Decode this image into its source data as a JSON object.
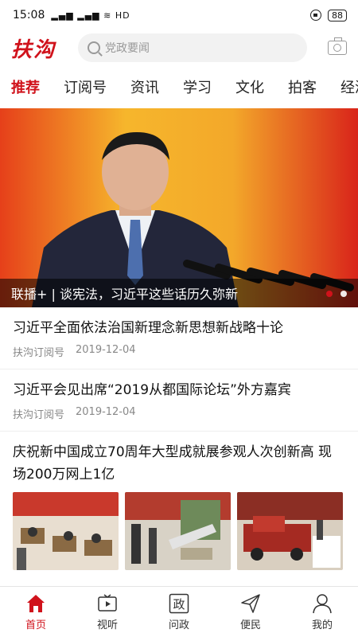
{
  "status_bar": {
    "time": "15:08",
    "signal": "▂▄▆ ▂▄▆ ≋ HD",
    "battery": "88"
  },
  "header": {
    "logo": "扶沟",
    "search_placeholder": "党政要闻"
  },
  "tabs": [
    "推荐",
    "订阅号",
    "资讯",
    "学习",
    "文化",
    "拍客",
    "经济"
  ],
  "banner": {
    "caption": "联播+ | 谈宪法，习近平这些话历久弥新"
  },
  "news": [
    {
      "title": "习近平全面依法治国新理念新思想新战略十论",
      "source": "扶沟订阅号",
      "date": "2019-12-04"
    },
    {
      "title": "习近平会见出席“2019从都国际论坛”外方嘉宾",
      "source": "扶沟订阅号",
      "date": "2019-12-04"
    },
    {
      "title": "庆祝新中国成立70周年大型成就展参观人次创新高 现场200万网上1亿"
    }
  ],
  "bottom_nav": [
    {
      "label": "首页",
      "icon": "home-icon"
    },
    {
      "label": "视听",
      "icon": "tv-icon"
    },
    {
      "label": "问政",
      "icon": "zheng-icon"
    },
    {
      "label": "便民",
      "icon": "send-icon"
    },
    {
      "label": "我的",
      "icon": "user-icon"
    }
  ],
  "colors": {
    "accent": "#d0121b"
  }
}
